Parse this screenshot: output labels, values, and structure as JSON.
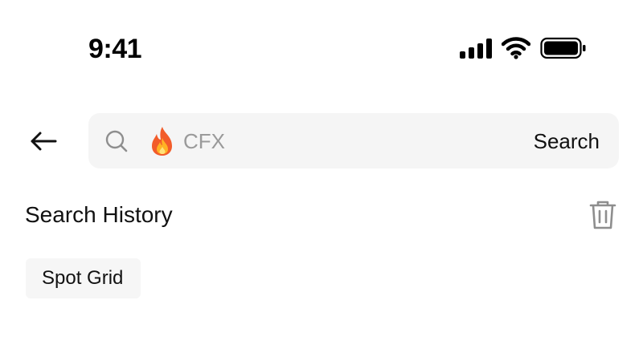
{
  "status_bar": {
    "time": "9:41",
    "icons": [
      "cellular-signal-icon",
      "wifi-icon",
      "battery-icon"
    ]
  },
  "header": {
    "back_icon": "arrow-left-icon",
    "search": {
      "icon": "search-icon",
      "trending_icon": "fire-icon",
      "placeholder": "CFX",
      "value": "",
      "submit_label": "Search"
    }
  },
  "history": {
    "title": "Search History",
    "clear_icon": "trash-icon",
    "items": [
      {
        "label": "Spot Grid"
      }
    ]
  },
  "colors": {
    "background": "#ffffff",
    "search_bar": "#f5f5f5",
    "chip": "#f6f6f6",
    "placeholder": "#9a9a9a",
    "text": "#111111",
    "icon_gray": "#8e8e8e"
  }
}
